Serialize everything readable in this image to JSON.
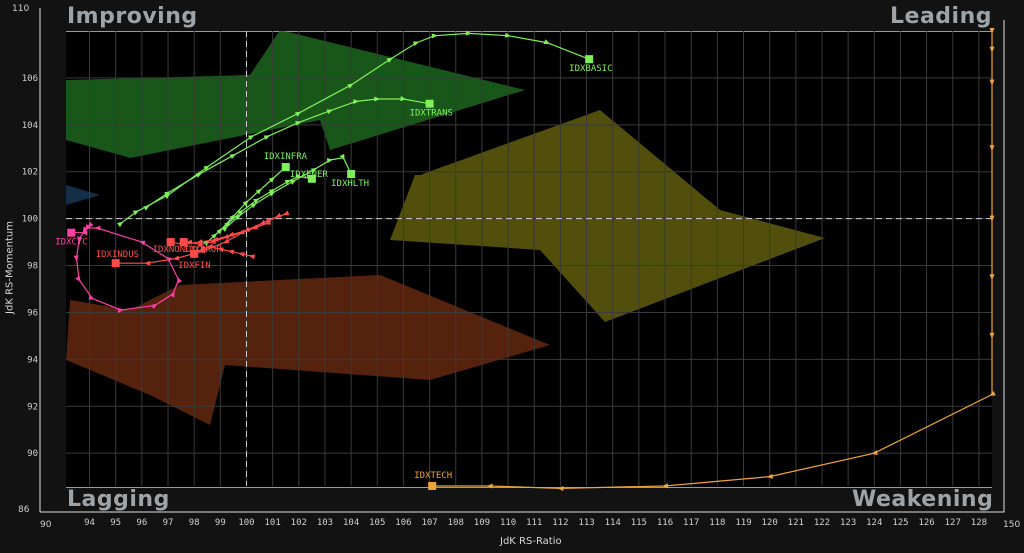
{
  "chart_data": {
    "type": "scatter",
    "title": "",
    "xlabel": "JdK RS-Ratio",
    "ylabel": "JdK RS-Momentum",
    "xlim": [
      93.1,
      128.5
    ],
    "ylim": [
      88.6,
      108.0
    ],
    "y_outer_labels": [
      "110",
      "86"
    ],
    "x_outer_labels": [
      "90",
      "150"
    ],
    "x_ticks": [
      94,
      95,
      96,
      97,
      98,
      99,
      100,
      101,
      102,
      103,
      104,
      105,
      106,
      107,
      108,
      109,
      110,
      111,
      112,
      113,
      114,
      115,
      116,
      117,
      118,
      119,
      120,
      121,
      122,
      123,
      124,
      125,
      126,
      127,
      128
    ],
    "y_ticks": [
      90,
      92,
      94,
      96,
      98,
      100,
      102,
      104,
      106
    ],
    "reference_lines": {
      "x": 100,
      "y": 100
    },
    "grid": true,
    "quadrants": {
      "top_left": "Improving",
      "top_right": "Leading",
      "bottom_left": "Lagging",
      "bottom_right": "Weakening"
    },
    "colors": {
      "leading_green": "#7ef05a",
      "lagging_red": "#ff4a4a",
      "cyc_pink": "#ff3fa5",
      "weakening_orange": "#f0a33a"
    },
    "series": [
      {
        "name": "IDXBASIC",
        "color": "#7ef05a",
        "x": [
          95.2,
          95.8,
          97.0,
          98.5,
          100.2,
          102.0,
          104.0,
          105.5,
          106.5,
          107.2,
          108.5,
          110.0,
          111.5,
          113.1
        ],
        "y": [
          99.8,
          100.3,
          101.0,
          102.2,
          103.5,
          104.5,
          105.7,
          106.8,
          107.5,
          107.8,
          107.9,
          107.8,
          107.5,
          106.8
        ]
      },
      {
        "name": "IDXTRANS",
        "color": "#7ef05a",
        "x": [
          96.2,
          97.0,
          98.2,
          99.5,
          100.8,
          102.0,
          103.2,
          104.2,
          105.0,
          106.0,
          107.0
        ],
        "y": [
          100.5,
          101.1,
          101.9,
          102.7,
          103.5,
          104.1,
          104.6,
          105.0,
          105.1,
          105.1,
          104.9
        ]
      },
      {
        "name": "IDXINFRA",
        "color": "#7ef05a",
        "x": [
          98.5,
          99.0,
          99.5,
          100.0,
          100.5,
          101.0,
          101.5
        ],
        "y": [
          99.0,
          99.5,
          100.1,
          100.7,
          101.2,
          101.7,
          102.2
        ]
      },
      {
        "name": "IDXENER",
        "color": "#7ef05a",
        "x": [
          98.8,
          99.3,
          99.8,
          100.4,
          101.0,
          101.6,
          102.0,
          102.5
        ],
        "y": [
          99.3,
          99.8,
          100.3,
          100.8,
          101.2,
          101.6,
          101.8,
          101.7
        ]
      },
      {
        "name": "IDXHLTH",
        "color": "#7ef05a",
        "x": [
          99.2,
          99.7,
          100.3,
          101.0,
          101.8,
          102.6,
          103.2,
          103.7,
          104.0
        ],
        "y": [
          99.6,
          100.1,
          100.6,
          101.1,
          101.6,
          102.1,
          102.5,
          102.6,
          101.9
        ]
      },
      {
        "name": "IDXCYC",
        "color": "#ff3fa5",
        "x": [
          94.0,
          93.8,
          93.6,
          93.5,
          93.6,
          94.1,
          95.2,
          96.5,
          97.2,
          97.4,
          97.0,
          96.0,
          94.3,
          93.9,
          93.8,
          93.3
        ],
        "y": [
          99.7,
          99.5,
          99.1,
          98.3,
          97.4,
          96.6,
          96.1,
          96.3,
          96.8,
          97.4,
          98.3,
          99.0,
          99.6,
          99.6,
          99.4,
          99.4
        ]
      },
      {
        "name": "IDXINDUS",
        "color": "#ff4a4a",
        "x": [
          101.5,
          100.8,
          100.0,
          99.2,
          98.3,
          97.3,
          96.2,
          95.0
        ],
        "y": [
          100.2,
          99.9,
          99.5,
          99.0,
          98.6,
          98.3,
          98.1,
          98.1
        ]
      },
      {
        "name": "IDXNONCYC",
        "color": "#ff4a4a",
        "x": [
          101.2,
          100.6,
          100.0,
          99.4,
          98.8,
          98.2,
          97.6,
          97.1
        ],
        "y": [
          100.1,
          99.8,
          99.5,
          99.3,
          99.1,
          99.0,
          98.9,
          99.0
        ]
      },
      {
        "name": "IDXPROP",
        "color": "#ff4a4a",
        "x": [
          100.8,
          100.3,
          99.8,
          99.2,
          98.7,
          98.2,
          97.8,
          97.6
        ],
        "y": [
          99.8,
          99.6,
          99.4,
          99.2,
          99.0,
          98.9,
          99.0,
          99.0
        ]
      },
      {
        "name": "IDXFIN",
        "color": "#ff4a4a",
        "x": [
          100.2,
          99.8,
          99.4,
          99.0,
          98.6,
          98.3,
          98.0
        ],
        "y": [
          98.4,
          98.5,
          98.6,
          98.7,
          98.8,
          98.7,
          98.5
        ]
      },
      {
        "name": "IDXTECH",
        "color": "#f0a33a",
        "x": [
          128.5,
          128.5,
          128.5,
          128.5,
          128.5,
          128.5,
          128.5,
          128.5,
          124.0,
          120.0,
          116.0,
          112.0,
          109.3,
          107.1
        ],
        "y": [
          108.0,
          107.2,
          105.8,
          103.0,
          100.0,
          97.5,
          95.0,
          92.5,
          90.0,
          89.0,
          88.6,
          88.5,
          88.6,
          88.6
        ]
      }
    ]
  }
}
